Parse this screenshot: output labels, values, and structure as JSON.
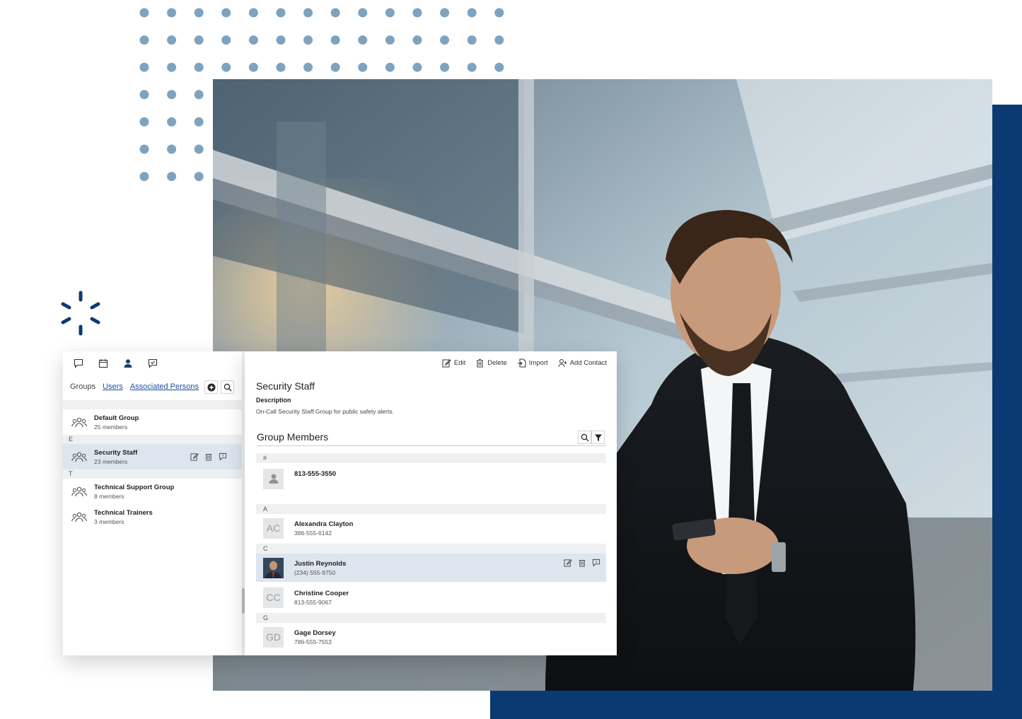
{
  "colors": {
    "dots": "#7fa3bf",
    "navy": "#0b3a73",
    "selected_row": "#dde6ef",
    "link": "#1d4f9a"
  },
  "sidebar": {
    "toolbar_icons": [
      "chat-icon",
      "calendar-icon",
      "person-icon",
      "feedback-icon"
    ],
    "tabs": {
      "groups": "Groups",
      "users": "Users",
      "associated": "Associated Persons"
    },
    "sections": [
      {
        "letter": "",
        "items": [
          {
            "name": "Default Group",
            "count": "25 members",
            "selected": false
          }
        ]
      },
      {
        "letter": "E",
        "items": [
          {
            "name": "Security Staff",
            "count": "23 members",
            "selected": true
          }
        ]
      },
      {
        "letter": "T",
        "items": [
          {
            "name": "Technical Support Group",
            "count": "8 members",
            "selected": false
          },
          {
            "name": "Technical Trainers",
            "count": "3 members",
            "selected": false
          }
        ]
      }
    ]
  },
  "detail": {
    "actions": {
      "edit": "Edit",
      "delete": "Delete",
      "import": "Import",
      "add_contact": "Add Contact"
    },
    "title": "Security Staff",
    "description_label": "Description",
    "description": "On-Call Security Staff Group for public safety alerts.",
    "members_title": "Group Members",
    "members": [
      {
        "letter": "#",
        "rows": [
          {
            "initials": "",
            "avatar": "person-icon",
            "name": "813-555-3550",
            "phone": "",
            "selected": false
          }
        ]
      },
      {
        "letter": "A",
        "rows": [
          {
            "initials": "AC",
            "avatar": "initials",
            "name": "Alexandra Clayton",
            "phone": "386-555-6142",
            "selected": false
          }
        ]
      },
      {
        "letter": "C",
        "rows": [
          {
            "initials": "",
            "avatar": "photo",
            "name": "Justin Reynolds",
            "phone": "(234) 555-9750",
            "selected": true
          },
          {
            "initials": "CC",
            "avatar": "initials",
            "name": "Christine Cooper",
            "phone": "813-555-9067",
            "selected": false
          }
        ]
      },
      {
        "letter": "G",
        "rows": [
          {
            "initials": "GD",
            "avatar": "initials",
            "name": "Gage Dorsey",
            "phone": "786-555-7553",
            "selected": false
          }
        ]
      }
    ]
  }
}
